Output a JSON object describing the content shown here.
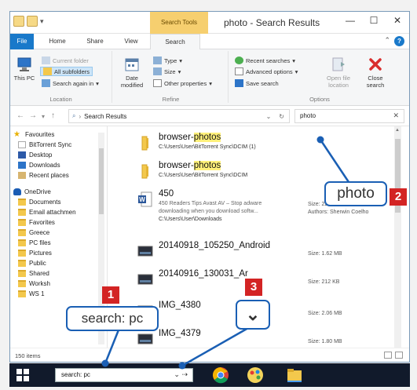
{
  "window": {
    "title": "photo - Search Results",
    "context_tab": "Search Tools",
    "controls": [
      "—",
      "☐",
      "✕"
    ]
  },
  "tabs": [
    "File",
    "Home",
    "Share",
    "View",
    "Search"
  ],
  "ribbon": {
    "location": {
      "label": "Location",
      "this_pc": "This PC",
      "current_folder": "Current folder",
      "all_subfolders": "All subfolders",
      "search_again": "Search again in"
    },
    "refine": {
      "label": "Refine",
      "date_modified": "Date modified",
      "type": "Type",
      "size": "Size",
      "other_properties": "Other properties"
    },
    "options": {
      "label": "Options",
      "recent_searches": "Recent searches",
      "advanced_options": "Advanced options",
      "save_search": "Save search",
      "open_file_location": "Open file location",
      "close_search": "Close search"
    }
  },
  "address": {
    "path": "Search Results",
    "search_value": "photo"
  },
  "nav_pane": {
    "items": [
      {
        "label": "Favourites",
        "icon": "star-icon"
      },
      {
        "label": "BitTorrent Sync",
        "icon": "page-icon"
      },
      {
        "label": "Desktop",
        "icon": "desktop-icon"
      },
      {
        "label": "Downloads",
        "icon": "download-icon"
      },
      {
        "label": "Recent places",
        "icon": "recent-icon"
      },
      {
        "label": "OneDrive",
        "icon": "cloud-icon"
      },
      {
        "label": "Documents",
        "icon": "folder-icon"
      },
      {
        "label": "Email attachmen",
        "icon": "folder-icon"
      },
      {
        "label": "Favorites",
        "icon": "folder-icon"
      },
      {
        "label": "Greece",
        "icon": "folder-icon"
      },
      {
        "label": "PC files",
        "icon": "folder-icon"
      },
      {
        "label": "Pictures",
        "icon": "folder-icon"
      },
      {
        "label": "Public",
        "icon": "folder-icon"
      },
      {
        "label": "Shared",
        "icon": "folder-icon"
      },
      {
        "label": "Worksh",
        "icon": "folder-icon"
      },
      {
        "label": "WS 1",
        "icon": "folder-icon"
      }
    ]
  },
  "files": [
    {
      "name_pre": "browser-",
      "name_hl": "photos",
      "name_post": "",
      "path": "C:\\Users\\User\\BitTorrent Sync\\DCIM (1)",
      "icon": "folder-icon"
    },
    {
      "name_pre": "browser-",
      "name_hl": "photos",
      "name_post": "",
      "path": "C:\\Users\\User\\BitTorrent Sync\\DCIM",
      "icon": "folder-icon"
    },
    {
      "name_pre": "450",
      "name_hl": "",
      "name_post": "",
      "snippet1": "450 Readers Tips Avast AV – Stop adware",
      "snippet2": "downloading when you download softw...",
      "path": "C:\\Users\\User\\Downloads",
      "meta1": "Size: 22.5 MB",
      "meta2": "Authors: Sherwin Coelho",
      "icon": "word-doc-icon"
    },
    {
      "name_pre": "20140918_105250_Android",
      "name_hl": "",
      "name_post": "",
      "meta1": "Size: 1.62 MB",
      "icon": "image-icon"
    },
    {
      "name_pre": "20140916_130031_Ar",
      "name_hl": "",
      "name_post": "",
      "meta1": "Size: 212 KB",
      "icon": "image-icon"
    },
    {
      "name_pre": "IMG_4380",
      "name_hl": "",
      "name_post": "",
      "meta1": "Size: 2.06 MB",
      "icon": "image-icon"
    },
    {
      "name_pre": "IMG_4379",
      "name_hl": "",
      "name_post": "",
      "meta1": "Size: 1.80 MB",
      "icon": "image-icon"
    }
  ],
  "status": {
    "items_count": "150 items"
  },
  "taskbar": {
    "search_value": "search: pc"
  },
  "callouts": {
    "c1": {
      "number": "1",
      "text": "search: pc"
    },
    "c2": {
      "number": "2",
      "text": "photo"
    },
    "c3": {
      "number": "3",
      "text": "⌄"
    }
  },
  "colors": {
    "accent": "#1979ca",
    "callout_badge": "#d32424",
    "callout_border": "#1a5fb4",
    "highlight": "#fff07a"
  }
}
